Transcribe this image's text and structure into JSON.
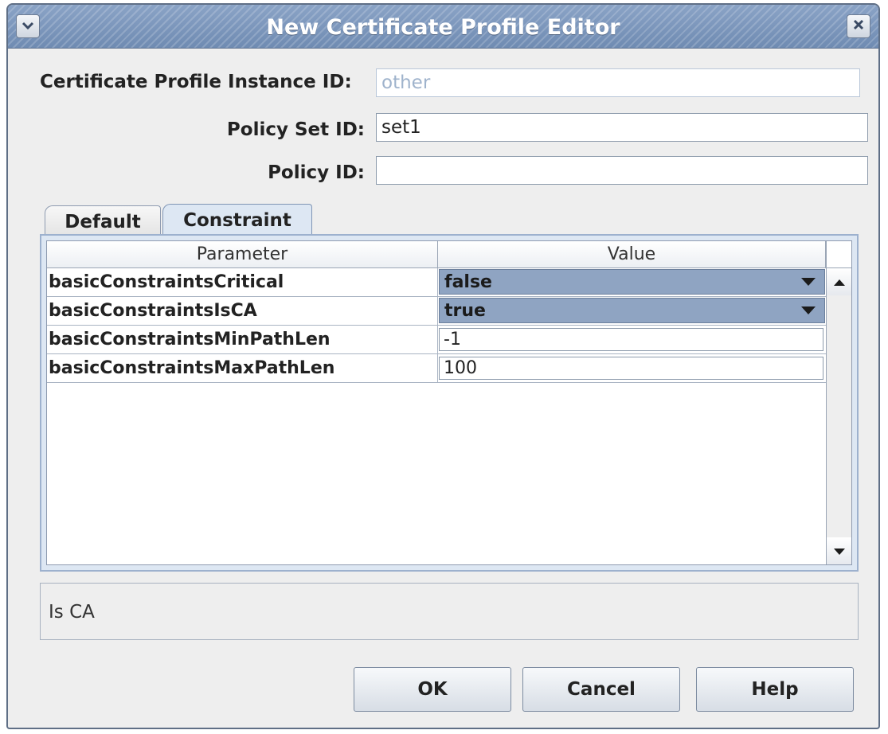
{
  "window": {
    "title": "New Certificate Profile Editor"
  },
  "form": {
    "instance_id_label": "Certificate Profile Instance ID:",
    "instance_id_value": "other",
    "policy_set_label": "Policy Set ID:",
    "policy_set_value": "set1",
    "policy_id_label": "Policy ID:",
    "policy_id_value": ""
  },
  "tabs": [
    {
      "label": "Default",
      "selected": false
    },
    {
      "label": "Constraint",
      "selected": true
    }
  ],
  "table": {
    "columns": [
      "Parameter",
      "Value"
    ],
    "rows": [
      {
        "param": "basicConstraintsCritical",
        "value": "false",
        "kind": "combo"
      },
      {
        "param": "basicConstraintsIsCA",
        "value": "true",
        "kind": "combo"
      },
      {
        "param": "basicConstraintsMinPathLen",
        "value": "-1",
        "kind": "text"
      },
      {
        "param": "basicConstraintsMaxPathLen",
        "value": "100",
        "kind": "text"
      }
    ]
  },
  "description": {
    "text": "Is CA"
  },
  "buttons": {
    "ok": "OK",
    "cancel": "Cancel",
    "help": "Help"
  },
  "icons": {
    "window_menu": "chevron-down-icon",
    "close": "close-icon",
    "combo_arrow": "triangle-down-icon",
    "scroll_up": "triangle-up-icon",
    "scroll_down": "triangle-down-icon"
  },
  "colors": {
    "titlebar": "#7d97bc",
    "selected_combo": "#8fa4c2",
    "panel": "#dde7f3",
    "window_bg": "#eeeeee"
  }
}
